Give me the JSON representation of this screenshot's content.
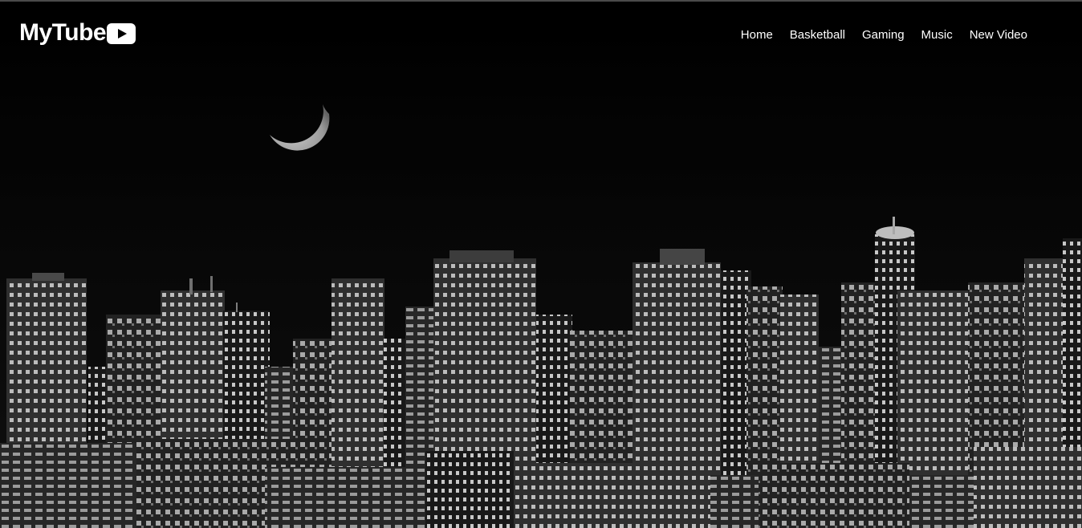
{
  "brand": {
    "name": "MyTube",
    "icon": "play-icon"
  },
  "nav": {
    "items": [
      "Home",
      "Basketball",
      "Gaming",
      "Music",
      "New Video"
    ]
  },
  "colors": {
    "background": "#000000",
    "text": "#ffffff"
  }
}
